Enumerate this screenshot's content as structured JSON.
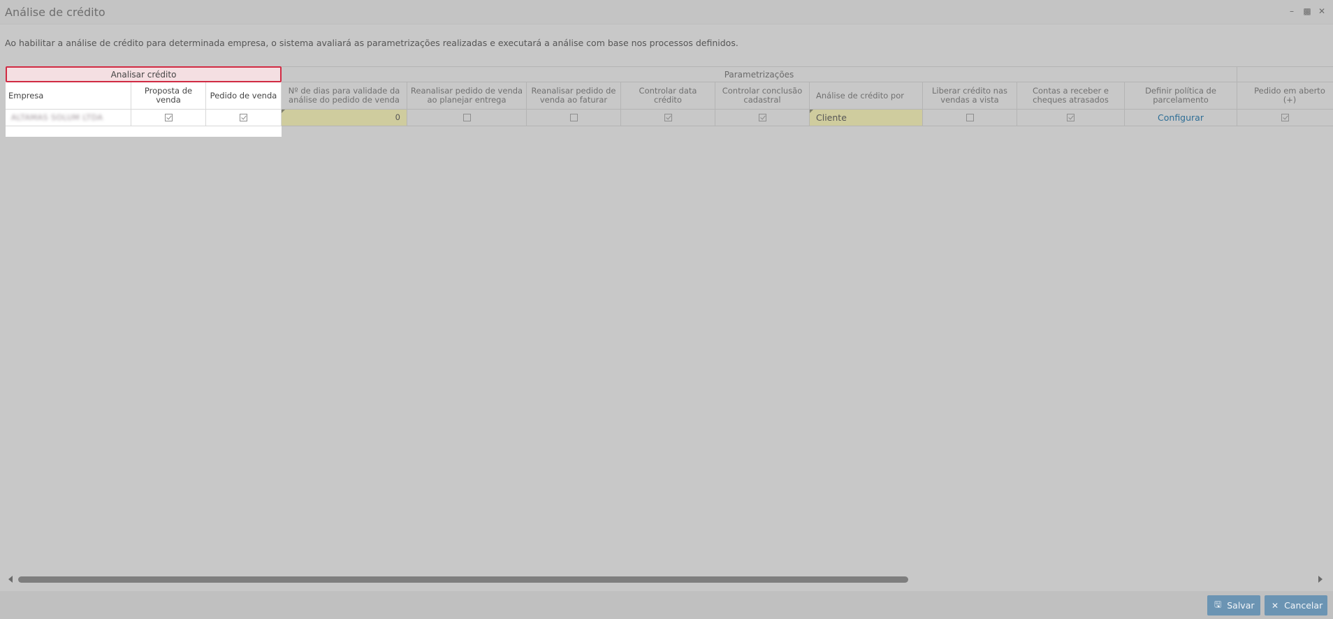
{
  "window": {
    "title": "Análise de crédito",
    "controls": [
      "minimize-icon",
      "restore-icon",
      "close-icon"
    ]
  },
  "description": "Ao habilitar a análise de crédito para determinada empresa, o sistema avaliará as parametrizações realizadas e executará a análise com base nos processos definidos.",
  "table": {
    "groups": {
      "analisar": "Analisar crédito",
      "param": "Parametrizações"
    },
    "headers": {
      "empresa": "Empresa",
      "proposta": "Proposta de venda",
      "pedido": "Pedido de venda",
      "dias": "Nº de dias para validade da análise do pedido de venda",
      "reanalisar_planejar": "Reanalisar pedido de venda ao planejar entrega",
      "reanalisar_faturar": "Reanalisar pedido de venda ao faturar",
      "controlar_data": "Controlar data crédito",
      "controlar_conclusao": "Controlar conclusão cadastral",
      "analise_por": "Análise de crédito por",
      "liberar": "Liberar crédito nas vendas a vista",
      "contas": "Contas a receber e cheques atrasados",
      "politica": "Definir política de parcelamento",
      "pedido_aberto": "Pedido em aberto (+)"
    },
    "row": {
      "empresa": "ALTAMAS SOLUM LTDA",
      "proposta": true,
      "pedido": true,
      "dias": "0",
      "reanalisar_planejar": false,
      "reanalisar_faturar": false,
      "controlar_data": true,
      "controlar_conclusao": true,
      "analise_por": "Cliente",
      "liberar": false,
      "contas": true,
      "politica_link": "Configurar",
      "pedido_aberto": true
    }
  },
  "footer": {
    "save": "Salvar",
    "cancel": "Cancelar"
  },
  "colors": {
    "accent_button": "#6b94b3",
    "error_border": "#d12a43",
    "editable_cell": "#cfcc9e"
  }
}
